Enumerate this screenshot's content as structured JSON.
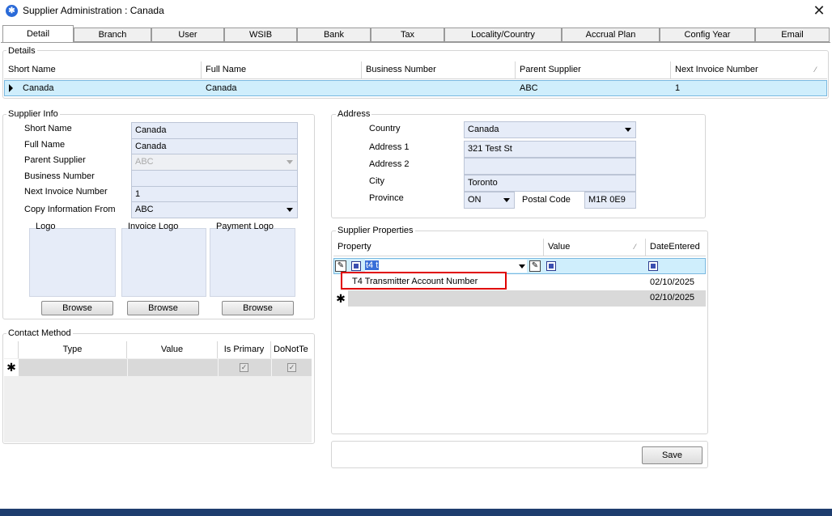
{
  "window": {
    "title": "Supplier Administration : Canada",
    "icon": "app-logo-icon",
    "close": "✕"
  },
  "tabs": [
    "Detail",
    "Branch",
    "User",
    "WSIB",
    "Bank",
    "Tax",
    "Locality/Country",
    "Accrual Plan",
    "Config Year",
    "Email"
  ],
  "details": {
    "legend": "Details",
    "columns": [
      "Short Name",
      "Full Name",
      "Business Number",
      "Parent Supplier",
      "Next Invoice Number"
    ],
    "row": [
      "Canada",
      "Canada",
      "",
      "ABC",
      "1"
    ]
  },
  "supplier_info": {
    "legend": "Supplier Info",
    "labels": {
      "short_name": "Short Name",
      "full_name": "Full Name",
      "parent_supplier": "Parent Supplier",
      "business_number": "Business Number",
      "next_invoice_number": "Next Invoice Number",
      "copy_information_from": "Copy Information From"
    },
    "values": {
      "short_name": "Canada",
      "full_name": "Canada",
      "parent_supplier": "ABC",
      "business_number": "",
      "next_invoice_number": "1",
      "copy_information_from": "ABC"
    },
    "logos": [
      "Logo",
      "Invoice Logo",
      "Payment Logo"
    ],
    "browse_label": "Browse"
  },
  "address": {
    "legend": "Address",
    "labels": {
      "country": "Country",
      "address1": "Address 1",
      "address2": "Address 2",
      "city": "City",
      "province": "Province",
      "postal_code": "Postal Code"
    },
    "values": {
      "country": "Canada",
      "address1": "321 Test St",
      "address2": "",
      "city": "Toronto",
      "province": "ON",
      "postal_code": "M1R 0E9"
    }
  },
  "supplier_properties": {
    "legend": "Supplier Properties",
    "columns": [
      "Property",
      "Value",
      "DateEntered"
    ],
    "edit_text": "t4 t",
    "dropdown_item": "T4 Transmitter Account Number",
    "dates": [
      "02/10/2025",
      "02/10/2025"
    ],
    "highlight_color": "#e00000"
  },
  "contact_method": {
    "legend": "Contact Method",
    "columns": [
      "Type",
      "Value",
      "Is Primary",
      "DoNotTe"
    ]
  },
  "save_label": "Save",
  "colors": {
    "grid_selected": "#cfeefc",
    "input_bg": "#e6ecf8",
    "highlight": "#e00000"
  }
}
